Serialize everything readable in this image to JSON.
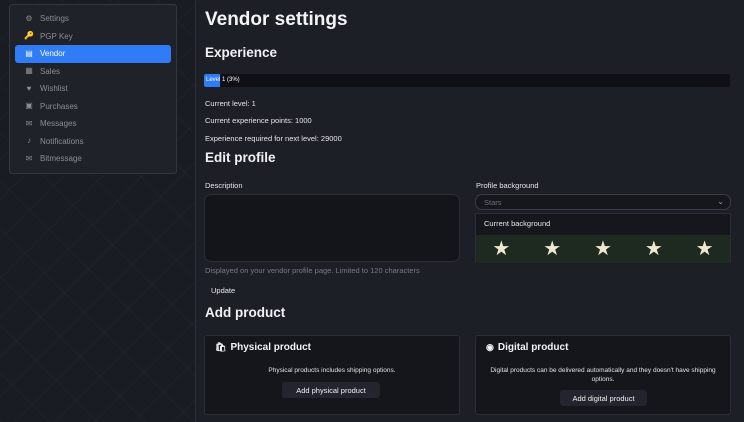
{
  "sidebar": {
    "items": [
      {
        "label": "Settings",
        "icon": "gear-icon",
        "active": false
      },
      {
        "label": "PGP Key",
        "icon": "key-icon",
        "active": false
      },
      {
        "label": "Vendor",
        "icon": "id-card-icon",
        "active": true
      },
      {
        "label": "Sales",
        "icon": "sales-icon",
        "active": false
      },
      {
        "label": "Wishlist",
        "icon": "heart-icon",
        "active": false
      },
      {
        "label": "Purchases",
        "icon": "cart-icon",
        "active": false
      },
      {
        "label": "Messages",
        "icon": "chat-icon",
        "active": false
      },
      {
        "label": "Notifications",
        "icon": "bell-icon",
        "active": false
      },
      {
        "label": "Bitmessage",
        "icon": "envelope-icon",
        "active": false
      }
    ]
  },
  "page": {
    "title": "Vendor settings"
  },
  "experience": {
    "heading": "Experience",
    "bar_label": "Level 1 (3%)",
    "progress_percent": 3,
    "current_level": "Current level: 1",
    "points": "Current experience points: 1000",
    "required": "Experience required for next level: 29000"
  },
  "edit_profile": {
    "heading": "Edit profile",
    "description_label": "Description",
    "description_value": "",
    "hint": "Displayed on your vendor profile page. Limited to 120 characters",
    "update_label": "Update",
    "background_label": "Profile background",
    "background_selected": "Stars",
    "current_background_label": "Current background"
  },
  "add_product": {
    "heading": "Add product",
    "physical": {
      "title": "Physical product",
      "text": "Physical products includes shipping options.",
      "button": "Add physical product"
    },
    "digital": {
      "title": "Digital product",
      "text": "Digital products can be delivered automatically and they doesn't have shipping options.",
      "button": "Add digital product"
    }
  },
  "colors": {
    "accent": "#2f7cf6",
    "background": "#1a1c24"
  }
}
